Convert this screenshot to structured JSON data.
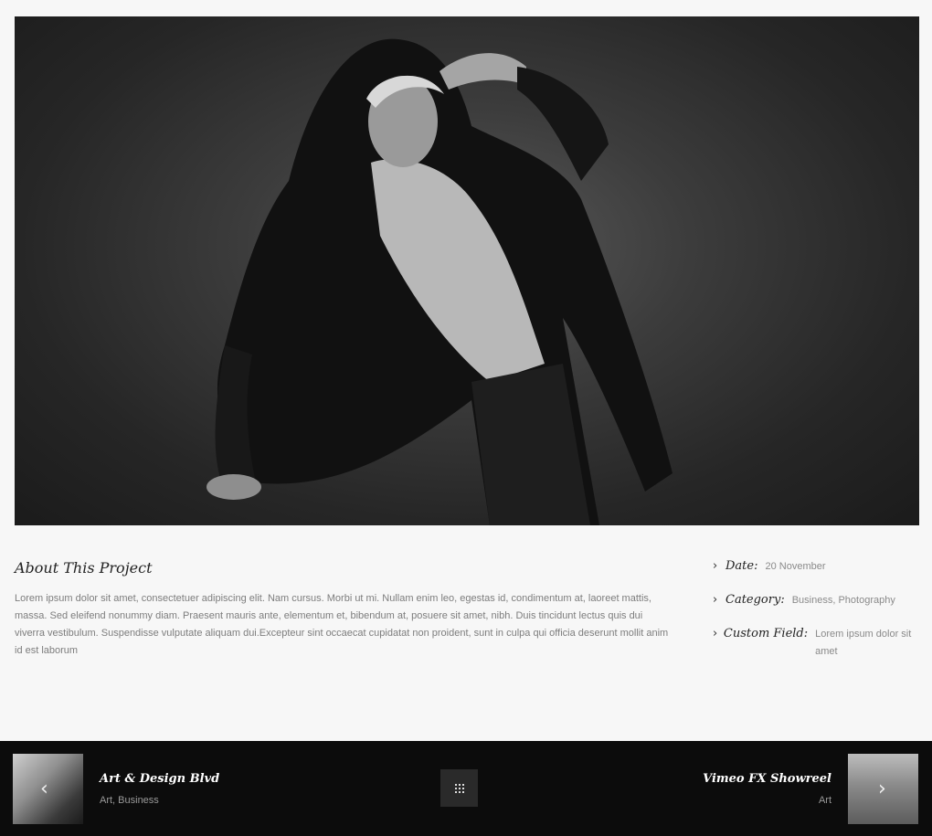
{
  "hero": {
    "icon": "photo-image"
  },
  "about": {
    "title": "About This Project",
    "text": "Lorem ipsum dolor sit amet, consectetuer adipiscing elit. Nam cursus. Morbi ut mi. Nullam enim leo, egestas id, condimentum at, laoreet mattis, massa. Sed eleifend nonummy diam. Praesent mauris ante, elementum et, bibendum at, posuere sit amet, nibh. Duis tincidunt lectus quis dui viverra vestibulum. Suspendisse vulputate aliquam dui.Excepteur sint occaecat cupidatat non proident, sunt in culpa qui officia deserunt mollit anim id est laborum"
  },
  "meta": {
    "date_label": "Date:",
    "date_value": "20 November",
    "category_label": "Category:",
    "category_value": "Business, Photography",
    "custom_label": "Custom Field:",
    "custom_value": "Lorem ipsum dolor sit amet"
  },
  "footer": {
    "prev": {
      "title": "Art & Design Blvd",
      "sub": "Art, Business",
      "arrow": "‹"
    },
    "next": {
      "title": "Vimeo FX Showreel",
      "sub": "Art",
      "arrow": "›"
    },
    "grid_icon": "grid-icon"
  },
  "colors": {
    "footer_bg": "#0c0c0c",
    "page_bg": "#f7f7f7"
  }
}
